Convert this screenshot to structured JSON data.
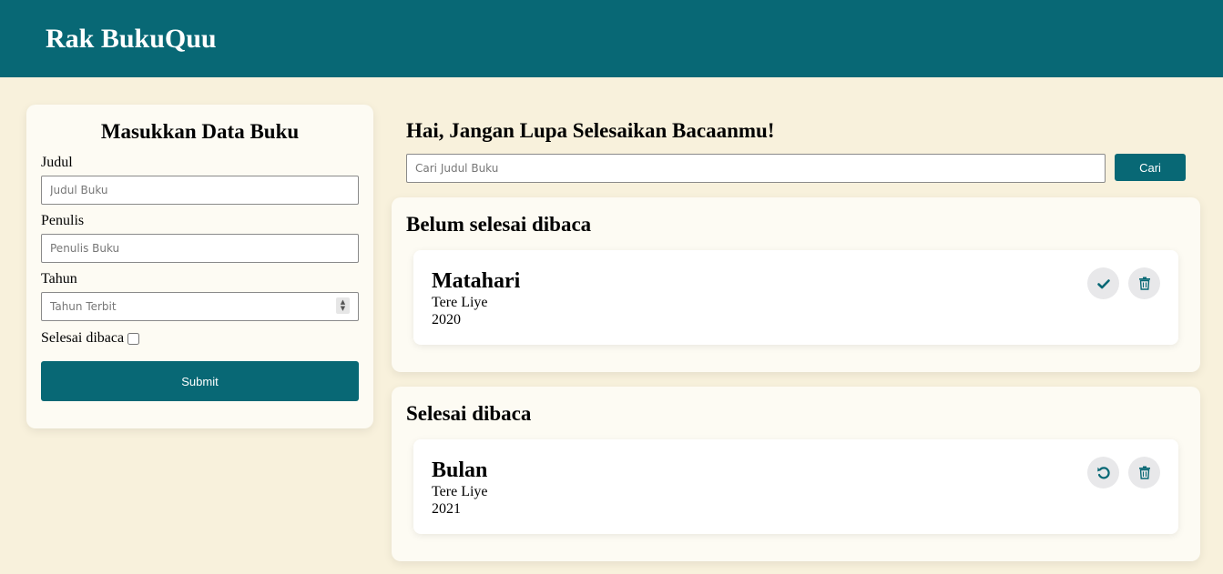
{
  "app": {
    "title": "Rak BukuQuu"
  },
  "form": {
    "heading": "Masukkan Data Buku",
    "title_label": "Judul",
    "title_placeholder": "Judul Buku",
    "author_label": "Penulis",
    "author_placeholder": "Penulis Buku",
    "year_label": "Tahun",
    "year_placeholder": "Tahun Terbit",
    "complete_label": "Selesai dibaca",
    "submit_label": "Submit"
  },
  "search": {
    "greeting": "Hai, Jangan Lupa Selesaikan Bacaanmu!",
    "placeholder": "Cari Judul Buku",
    "button_label": "Cari"
  },
  "shelves": {
    "unfinished": {
      "heading": "Belum selesai dibaca",
      "books": [
        {
          "title": "Matahari",
          "author": "Tere Liye",
          "year": "2020",
          "actions": [
            "check-icon",
            "trash-icon"
          ]
        }
      ]
    },
    "finished": {
      "heading": "Selesai dibaca",
      "books": [
        {
          "title": "Bulan",
          "author": "Tere Liye",
          "year": "2021",
          "actions": [
            "undo-icon",
            "trash-icon"
          ]
        }
      ]
    }
  },
  "colors": {
    "primary": "#086875",
    "background": "#f8f1dc",
    "card": "#fdfbf3",
    "icon_button_bg": "#e8e8ea"
  }
}
